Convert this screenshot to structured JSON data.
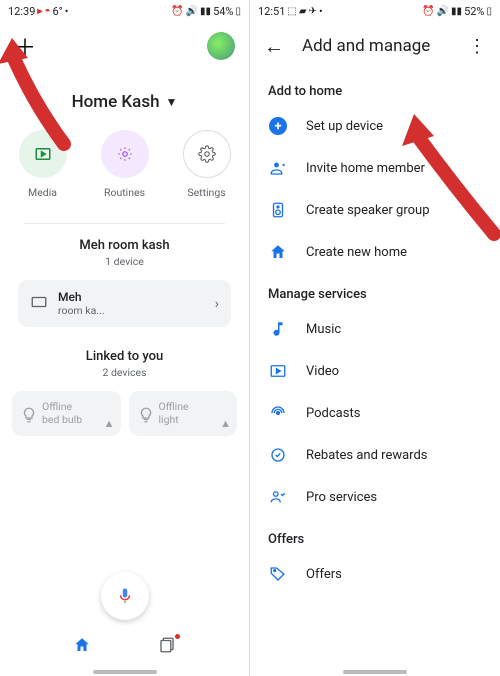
{
  "left": {
    "status": {
      "time": "12:39",
      "temp": "6°",
      "battery": "54%"
    },
    "home_name": "Home Kash",
    "actions": {
      "media": "Media",
      "routines": "Routines",
      "settings": "Settings"
    },
    "room": {
      "title": "Meh room kash",
      "sub": "1 device",
      "chip_name": "Meh",
      "chip_sub": "room ka..."
    },
    "linked": {
      "title": "Linked to you",
      "sub": "2 devices",
      "d1a": "Offline",
      "d1b": "bed bulb",
      "d2a": "Offline",
      "d2b": "light"
    }
  },
  "right": {
    "status": {
      "time": "12:51",
      "battery": "52%"
    },
    "title": "Add and manage",
    "sections": {
      "add": "Add to home",
      "manage": "Manage services",
      "offers": "Offers"
    },
    "items": {
      "setup": "Set up device",
      "invite": "Invite home member",
      "speaker": "Create speaker group",
      "newhome": "Create new home",
      "music": "Music",
      "video": "Video",
      "podcasts": "Podcasts",
      "rebates": "Rebates and rewards",
      "pro": "Pro services",
      "offers": "Offers"
    }
  }
}
